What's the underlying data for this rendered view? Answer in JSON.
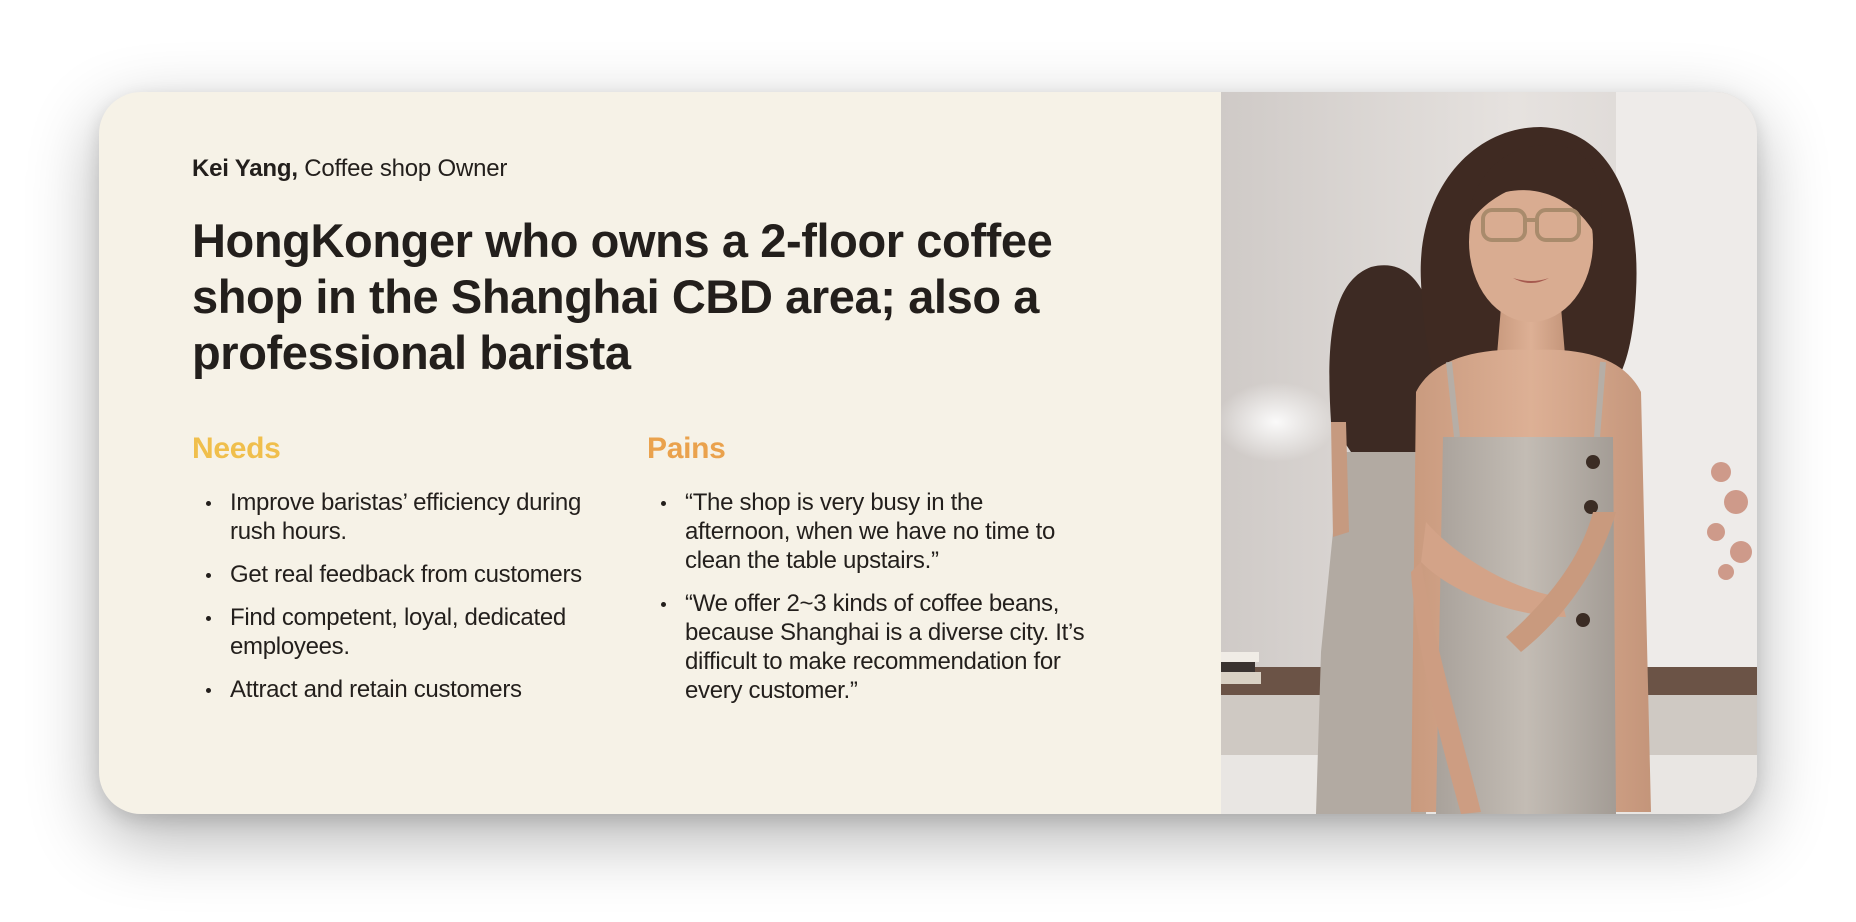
{
  "persona": {
    "name": "Kei Yang,",
    "role": "Coffee shop Owner"
  },
  "headline": "HongKonger who owns a 2-floor coffee shop in the Shanghai CBD area; also a professional barista",
  "needs": {
    "title": "Needs",
    "items": [
      "Improve baristas’ efficiency during rush hours.",
      "Get real feedback from customers",
      "Find competent, loyal, dedicated employees.",
      "Attract and retain customers"
    ]
  },
  "pains": {
    "title": "Pains",
    "items": [
      "“The shop is very busy in the afternoon, when we have no time to clean the table upstairs.”",
      "“We offer 2~3 kinds of coffee beans, because Shanghai is a diverse city. It’s difficult to make recommendation for every customer.”"
    ]
  },
  "colors": {
    "card_background": "#f6f2e7",
    "needs_accent": "#f0bf4c",
    "pains_accent": "#eaa24d",
    "text": "#231f1c"
  },
  "photo": {
    "subject": "portrait-photo"
  }
}
